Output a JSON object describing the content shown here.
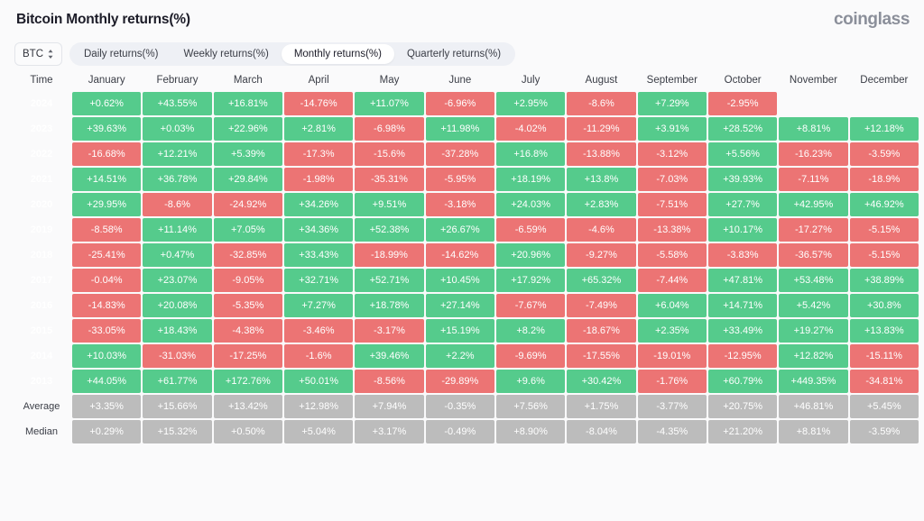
{
  "header": {
    "title": "Bitcoin Monthly returns(%)",
    "brand": "coinglass"
  },
  "controls": {
    "symbol": "BTC",
    "symbol_icon": "updown-chevrons-icon",
    "tabs": [
      {
        "label": "Daily returns(%)",
        "active": false
      },
      {
        "label": "Weekly returns(%)",
        "active": false
      },
      {
        "label": "Monthly returns(%)",
        "active": true
      },
      {
        "label": "Quarterly returns(%)",
        "active": false
      }
    ]
  },
  "colors": {
    "positive": "#55cb8c",
    "negative": "#ec7474",
    "neutral": "#bcbcbc",
    "background": "#fafafb",
    "tab_bar": "#eef0f5"
  },
  "table": {
    "columns": [
      "Time",
      "January",
      "February",
      "March",
      "April",
      "May",
      "June",
      "July",
      "August",
      "September",
      "October",
      "November",
      "December"
    ],
    "rows": [
      {
        "label": "2024",
        "kind": "year",
        "values": [
          "+0.62%",
          "+43.55%",
          "+16.81%",
          "-14.76%",
          "+11.07%",
          "-6.96%",
          "+2.95%",
          "-8.6%",
          "+7.29%",
          "-2.95%",
          "",
          ""
        ]
      },
      {
        "label": "2023",
        "kind": "year",
        "values": [
          "+39.63%",
          "+0.03%",
          "+22.96%",
          "+2.81%",
          "-6.98%",
          "+11.98%",
          "-4.02%",
          "-11.29%",
          "+3.91%",
          "+28.52%",
          "+8.81%",
          "+12.18%"
        ]
      },
      {
        "label": "2022",
        "kind": "year",
        "values": [
          "-16.68%",
          "+12.21%",
          "+5.39%",
          "-17.3%",
          "-15.6%",
          "-37.28%",
          "+16.8%",
          "-13.88%",
          "-3.12%",
          "+5.56%",
          "-16.23%",
          "-3.59%"
        ]
      },
      {
        "label": "2021",
        "kind": "year",
        "values": [
          "+14.51%",
          "+36.78%",
          "+29.84%",
          "-1.98%",
          "-35.31%",
          "-5.95%",
          "+18.19%",
          "+13.8%",
          "-7.03%",
          "+39.93%",
          "-7.11%",
          "-18.9%"
        ]
      },
      {
        "label": "2020",
        "kind": "year",
        "values": [
          "+29.95%",
          "-8.6%",
          "-24.92%",
          "+34.26%",
          "+9.51%",
          "-3.18%",
          "+24.03%",
          "+2.83%",
          "-7.51%",
          "+27.7%",
          "+42.95%",
          "+46.92%"
        ]
      },
      {
        "label": "2019",
        "kind": "year",
        "values": [
          "-8.58%",
          "+11.14%",
          "+7.05%",
          "+34.36%",
          "+52.38%",
          "+26.67%",
          "-6.59%",
          "-4.6%",
          "-13.38%",
          "+10.17%",
          "-17.27%",
          "-5.15%"
        ]
      },
      {
        "label": "2018",
        "kind": "year",
        "values": [
          "-25.41%",
          "+0.47%",
          "-32.85%",
          "+33.43%",
          "-18.99%",
          "-14.62%",
          "+20.96%",
          "-9.27%",
          "-5.58%",
          "-3.83%",
          "-36.57%",
          "-5.15%"
        ]
      },
      {
        "label": "2017",
        "kind": "year",
        "values": [
          "-0.04%",
          "+23.07%",
          "-9.05%",
          "+32.71%",
          "+52.71%",
          "+10.45%",
          "+17.92%",
          "+65.32%",
          "-7.44%",
          "+47.81%",
          "+53.48%",
          "+38.89%"
        ]
      },
      {
        "label": "2016",
        "kind": "year",
        "values": [
          "-14.83%",
          "+20.08%",
          "-5.35%",
          "+7.27%",
          "+18.78%",
          "+27.14%",
          "-7.67%",
          "-7.49%",
          "+6.04%",
          "+14.71%",
          "+5.42%",
          "+30.8%"
        ]
      },
      {
        "label": "2015",
        "kind": "year",
        "values": [
          "-33.05%",
          "+18.43%",
          "-4.38%",
          "-3.46%",
          "-3.17%",
          "+15.19%",
          "+8.2%",
          "-18.67%",
          "+2.35%",
          "+33.49%",
          "+19.27%",
          "+13.83%"
        ]
      },
      {
        "label": "2014",
        "kind": "year",
        "values": [
          "+10.03%",
          "-31.03%",
          "-17.25%",
          "-1.6%",
          "+39.46%",
          "+2.2%",
          "-9.69%",
          "-17.55%",
          "-19.01%",
          "-12.95%",
          "+12.82%",
          "-15.11%"
        ]
      },
      {
        "label": "2013",
        "kind": "year",
        "values": [
          "+44.05%",
          "+61.77%",
          "+172.76%",
          "+50.01%",
          "-8.56%",
          "-29.89%",
          "+9.6%",
          "+30.42%",
          "-1.76%",
          "+60.79%",
          "+449.35%",
          "-34.81%"
        ]
      },
      {
        "label": "Average",
        "kind": "stat",
        "values": [
          "+3.35%",
          "+15.66%",
          "+13.42%",
          "+12.98%",
          "+7.94%",
          "-0.35%",
          "+7.56%",
          "+1.75%",
          "-3.77%",
          "+20.75%",
          "+46.81%",
          "+5.45%"
        ]
      },
      {
        "label": "Median",
        "kind": "stat",
        "values": [
          "+0.29%",
          "+15.32%",
          "+0.50%",
          "+5.04%",
          "+3.17%",
          "-0.49%",
          "+8.90%",
          "-8.04%",
          "-4.35%",
          "+21.20%",
          "+8.81%",
          "-3.59%"
        ]
      }
    ]
  },
  "chart_data": {
    "type": "heatmap",
    "title": "Bitcoin Monthly returns(%)",
    "xlabel": "",
    "ylabel": "Time",
    "categories": [
      "January",
      "February",
      "March",
      "April",
      "May",
      "June",
      "July",
      "August",
      "September",
      "October",
      "November",
      "December"
    ],
    "rows": [
      "2024",
      "2023",
      "2022",
      "2021",
      "2020",
      "2019",
      "2018",
      "2017",
      "2016",
      "2015",
      "2014",
      "2013",
      "Average",
      "Median"
    ],
    "values": [
      [
        0.62,
        43.55,
        16.81,
        -14.76,
        11.07,
        -6.96,
        2.95,
        -8.6,
        7.29,
        -2.95,
        null,
        null
      ],
      [
        39.63,
        0.03,
        22.96,
        2.81,
        -6.98,
        11.98,
        -4.02,
        -11.29,
        3.91,
        28.52,
        8.81,
        12.18
      ],
      [
        -16.68,
        12.21,
        5.39,
        -17.3,
        -15.6,
        -37.28,
        16.8,
        -13.88,
        -3.12,
        5.56,
        -16.23,
        -3.59
      ],
      [
        14.51,
        36.78,
        29.84,
        -1.98,
        -35.31,
        -5.95,
        18.19,
        13.8,
        -7.03,
        39.93,
        -7.11,
        -18.9
      ],
      [
        29.95,
        -8.6,
        -24.92,
        34.26,
        9.51,
        -3.18,
        24.03,
        2.83,
        -7.51,
        27.7,
        42.95,
        46.92
      ],
      [
        -8.58,
        11.14,
        7.05,
        34.36,
        52.38,
        26.67,
        -6.59,
        -4.6,
        -13.38,
        10.17,
        -17.27,
        -5.15
      ],
      [
        -25.41,
        0.47,
        -32.85,
        33.43,
        -18.99,
        -14.62,
        20.96,
        -9.27,
        -5.58,
        -3.83,
        -36.57,
        -5.15
      ],
      [
        -0.04,
        23.07,
        -9.05,
        32.71,
        52.71,
        10.45,
        17.92,
        65.32,
        -7.44,
        47.81,
        53.48,
        38.89
      ],
      [
        -14.83,
        20.08,
        -5.35,
        7.27,
        18.78,
        27.14,
        -7.67,
        -7.49,
        6.04,
        14.71,
        5.42,
        30.8
      ],
      [
        -33.05,
        18.43,
        -4.38,
        -3.46,
        -3.17,
        15.19,
        8.2,
        -18.67,
        2.35,
        33.49,
        19.27,
        13.83
      ],
      [
        10.03,
        -31.03,
        -17.25,
        -1.6,
        39.46,
        2.2,
        -9.69,
        -17.55,
        -19.01,
        -12.95,
        12.82,
        -15.11
      ],
      [
        44.05,
        61.77,
        172.76,
        50.01,
        -8.56,
        -29.89,
        9.6,
        30.42,
        -1.76,
        60.79,
        449.35,
        -34.81
      ],
      [
        3.35,
        15.66,
        13.42,
        12.98,
        7.94,
        -0.35,
        7.56,
        1.75,
        -3.77,
        20.75,
        46.81,
        5.45
      ],
      [
        0.29,
        15.32,
        0.5,
        5.04,
        3.17,
        -0.49,
        8.9,
        -8.04,
        -4.35,
        21.2,
        8.81,
        -3.59
      ]
    ],
    "legend": "Green = positive monthly return, Red = negative monthly return, Grey = summary statistic",
    "grid": false
  }
}
